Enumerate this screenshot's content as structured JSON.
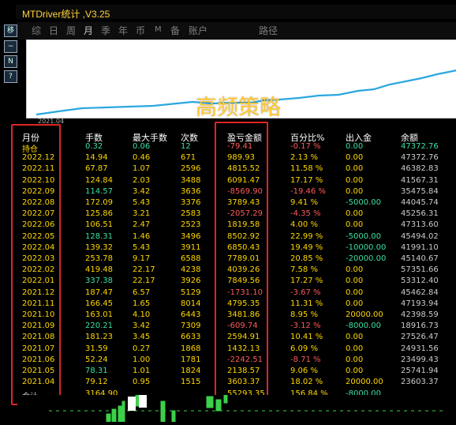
{
  "window": {
    "title": "MTDriver统计 ,V3.25"
  },
  "left_buttons": [
    "移",
    "~",
    "N",
    "?"
  ],
  "tabs": [
    "综",
    "日",
    "周",
    "月",
    "季",
    "年",
    "币",
    "M",
    "备",
    "账户",
    "路径"
  ],
  "active_tab": "月",
  "chart": {
    "start_label": "2021.04"
  },
  "overlay_label": "高频策略",
  "colors": {
    "title": "#ffd23a",
    "yellow": "#ffd700",
    "green": "#3be0a0",
    "red": "#ff5a5a",
    "box": "#e02424"
  },
  "table": {
    "headers": [
      "月份",
      "手数",
      "最大手数",
      "次数",
      "盈亏金额",
      "百分比%",
      "出入金",
      "余额"
    ],
    "rows": [
      {
        "month": "持仓",
        "lots": "0.32",
        "max_lots": "0.06",
        "count": "12",
        "pnl": "-79.41",
        "pct": "-0.17 %",
        "flow": "0.00",
        "balance": "47372.76"
      },
      {
        "month": "2022.12",
        "lots": "14.94",
        "max_lots": "0.46",
        "count": "671",
        "pnl": "989.93",
        "pct": "2.13 %",
        "flow": "0.00",
        "balance": "47372.76"
      },
      {
        "month": "2022.11",
        "lots": "67.87",
        "max_lots": "1.07",
        "count": "2596",
        "pnl": "4815.52",
        "pct": "11.58 %",
        "flow": "0.00",
        "balance": "46382.83"
      },
      {
        "month": "2022.10",
        "lots": "124.84",
        "max_lots": "2.03",
        "count": "3488",
        "pnl": "6091.47",
        "pct": "17.17 %",
        "flow": "0.00",
        "balance": "41567.31"
      },
      {
        "month": "2022.09",
        "lots": "114.57",
        "max_lots": "3.42",
        "count": "3636",
        "pnl": "-8569.90",
        "pct": "-19.46 %",
        "flow": "0.00",
        "balance": "35475.84"
      },
      {
        "month": "2022.08",
        "lots": "172.09",
        "max_lots": "5.43",
        "count": "3376",
        "pnl": "3789.43",
        "pct": "9.41 %",
        "flow": "-5000.00",
        "balance": "44045.74"
      },
      {
        "month": "2022.07",
        "lots": "125.86",
        "max_lots": "3.21",
        "count": "2583",
        "pnl": "-2057.29",
        "pct": "-4.35 %",
        "flow": "0.00",
        "balance": "45256.31"
      },
      {
        "month": "2022.06",
        "lots": "106.51",
        "max_lots": "2.47",
        "count": "2523",
        "pnl": "1819.58",
        "pct": "4.00 %",
        "flow": "0.00",
        "balance": "47313.60"
      },
      {
        "month": "2022.05",
        "lots": "128.31",
        "max_lots": "1.46",
        "count": "3496",
        "pnl": "8502.92",
        "pct": "22.99 %",
        "flow": "-5000.00",
        "balance": "45494.02"
      },
      {
        "month": "2022.04",
        "lots": "139.32",
        "max_lots": "5.43",
        "count": "3911",
        "pnl": "6850.43",
        "pct": "19.49 %",
        "flow": "-10000.00",
        "balance": "41991.10"
      },
      {
        "month": "2022.03",
        "lots": "253.78",
        "max_lots": "9.17",
        "count": "6588",
        "pnl": "7789.01",
        "pct": "20.85 %",
        "flow": "-20000.00",
        "balance": "45140.67"
      },
      {
        "month": "2022.02",
        "lots": "419.48",
        "max_lots": "22.17",
        "count": "4238",
        "pnl": "4039.26",
        "pct": "7.58 %",
        "flow": "0.00",
        "balance": "57351.66"
      },
      {
        "month": "2022.01",
        "lots": "337.38",
        "max_lots": "22.17",
        "count": "3926",
        "pnl": "7849.56",
        "pct": "17.27 %",
        "flow": "0.00",
        "balance": "53312.40"
      },
      {
        "month": "2021.12",
        "lots": "187.47",
        "max_lots": "6.57",
        "count": "5129",
        "pnl": "-1731.10",
        "pct": "-3.67 %",
        "flow": "0.00",
        "balance": "45462.84"
      },
      {
        "month": "2021.11",
        "lots": "166.45",
        "max_lots": "1.65",
        "count": "8014",
        "pnl": "4795.35",
        "pct": "11.31 %",
        "flow": "0.00",
        "balance": "47193.94"
      },
      {
        "month": "2021.10",
        "lots": "163.01",
        "max_lots": "4.10",
        "count": "6443",
        "pnl": "3481.86",
        "pct": "8.95 %",
        "flow": "20000.00",
        "balance": "42398.59"
      },
      {
        "month": "2021.09",
        "lots": "220.21",
        "max_lots": "3.42",
        "count": "7309",
        "pnl": "-609.74",
        "pct": "-3.12 %",
        "flow": "-8000.00",
        "balance": "18916.73"
      },
      {
        "month": "2021.08",
        "lots": "181.23",
        "max_lots": "3.45",
        "count": "6633",
        "pnl": "2594.91",
        "pct": "10.41 %",
        "flow": "0.00",
        "balance": "27526.47"
      },
      {
        "month": "2021.07",
        "lots": "31.59",
        "max_lots": "0.27",
        "count": "1868",
        "pnl": "1432.13",
        "pct": "6.09 %",
        "flow": "0.00",
        "balance": "24931.56"
      },
      {
        "month": "2021.06",
        "lots": "52.24",
        "max_lots": "1.00",
        "count": "1781",
        "pnl": "-2242.51",
        "pct": "-8.71 %",
        "flow": "0.00",
        "balance": "23499.43"
      },
      {
        "month": "2021.05",
        "lots": "78.31",
        "max_lots": "1.01",
        "count": "1824",
        "pnl": "2138.57",
        "pct": "9.06 %",
        "flow": "0.00",
        "balance": "25741.94"
      },
      {
        "month": "2021.04",
        "lots": "79.12",
        "max_lots": "0.95",
        "count": "1515",
        "pnl": "3603.37",
        "pct": "18.02 %",
        "flow": "20000.00",
        "balance": "23603.37"
      }
    ],
    "total": {
      "month": "合计",
      "lots": "3164.90",
      "pnl": "55293.35",
      "pct": "156.84 %",
      "flow": "-8000.00"
    }
  }
}
